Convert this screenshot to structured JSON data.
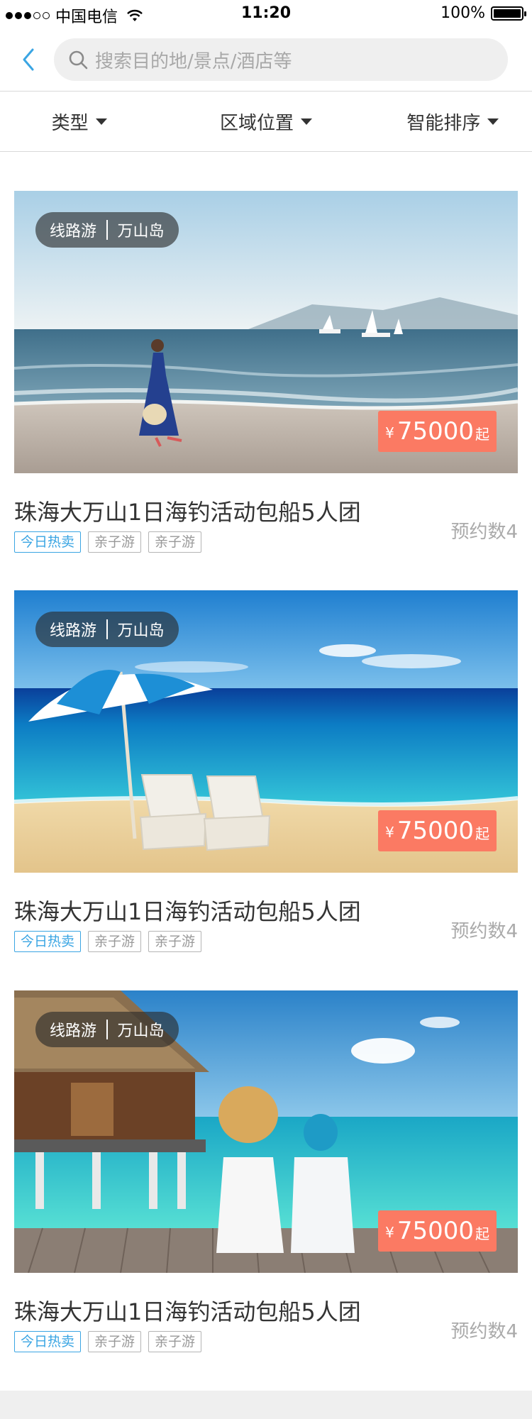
{
  "status_bar": {
    "carrier": "中国电信",
    "time": "11:20",
    "battery": "100%",
    "battery_level": 1.0,
    "signal_dots_filled": 3,
    "signal_dots_total": 5
  },
  "header": {
    "back_icon": "chevron-left-icon",
    "search_placeholder": "搜索目的地/景点/酒店等",
    "search_icon": "search-icon",
    "accent_color": "#3aa5e3"
  },
  "filters": [
    {
      "label": "类型"
    },
    {
      "label": "区域位置"
    },
    {
      "label": "智能排序"
    }
  ],
  "products": [
    {
      "type": "线路游",
      "location": "万山岛",
      "currency": "¥",
      "price": "75000",
      "price_suffix": "起",
      "title": "珠海大万山1日海钓活动包船5人团",
      "hot_tag": "今日热卖",
      "tags": [
        "亲子游",
        "亲子游"
      ],
      "booking": "预约数4",
      "image": "beach-woman-walking"
    },
    {
      "type": "线路游",
      "location": "万山岛",
      "currency": "¥",
      "price": "75000",
      "price_suffix": "起",
      "title": "珠海大万山1日海钓活动包船5人团",
      "hot_tag": "今日热卖",
      "tags": [
        "亲子游",
        "亲子游"
      ],
      "booking": "预约数4",
      "image": "beach-umbrella-chairs"
    },
    {
      "type": "线路游",
      "location": "万山岛",
      "currency": "¥",
      "price": "75000",
      "price_suffix": "起",
      "title": "珠海大万山1日海钓活动包船5人团",
      "hot_tag": "今日热卖",
      "tags": [
        "亲子游",
        "亲子游"
      ],
      "booking": "预约数4",
      "image": "water-villa-couple"
    }
  ],
  "colors": {
    "price_badge": "#fb7a63",
    "hot_tag": "#3aa5e3"
  }
}
